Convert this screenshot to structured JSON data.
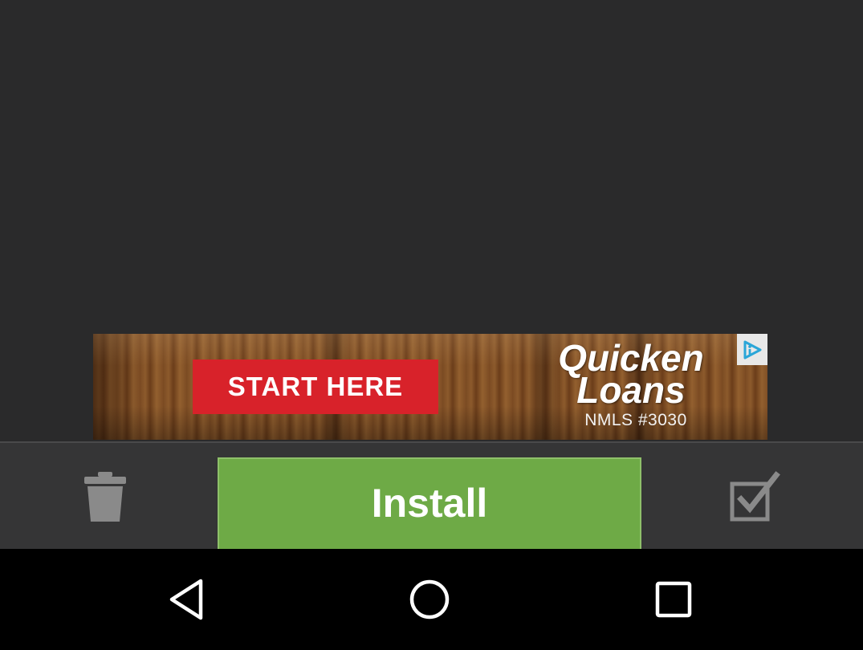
{
  "ad": {
    "cta_label": "START HERE",
    "brand_line1": "Quicken",
    "brand_line2": "Loans",
    "license_text": "NMLS #3030",
    "adchoices_icon": "adchoices-icon",
    "cta_color": "#d8222a"
  },
  "action_bar": {
    "install_label": "Install",
    "install_color": "#6eaa46",
    "trash_icon": "trash-icon",
    "check_icon": "checkbox-icon"
  },
  "nav_bar": {
    "back_icon": "back-icon",
    "home_icon": "home-icon",
    "recents_icon": "recents-icon"
  }
}
